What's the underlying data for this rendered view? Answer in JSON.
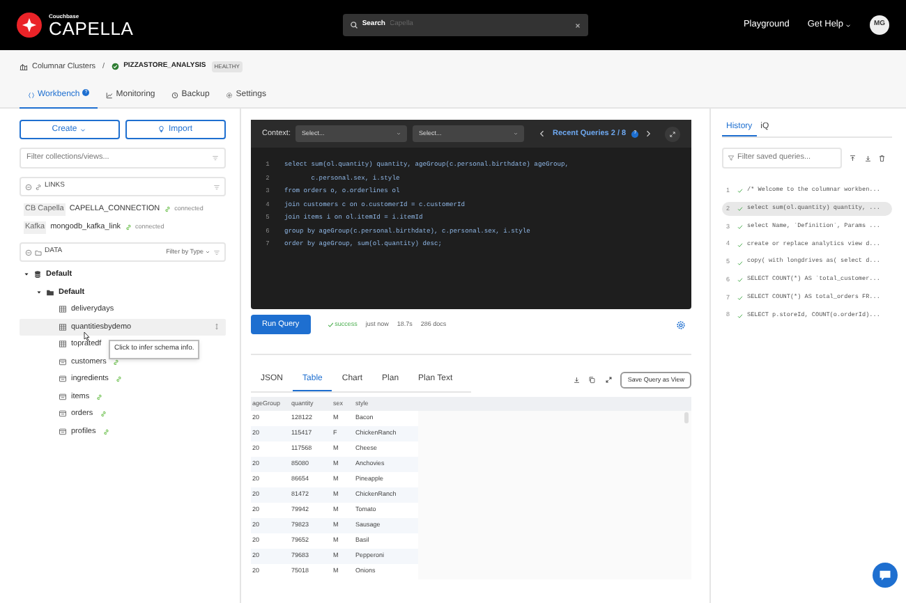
{
  "topbar": {
    "brand_small": "Couchbase",
    "brand": "CAPELLA",
    "search": {
      "label": "Search",
      "placeholder": "Capella"
    },
    "links": [
      "Playground",
      "Get Help"
    ],
    "avatar": "MG"
  },
  "breadcrumb": {
    "parent": "Columnar Clusters",
    "separator": "/",
    "cluster": "PIZZASTORE_ANALYSIS",
    "status": "HEALTHY"
  },
  "tabs": [
    {
      "label": "Workbench",
      "selected": true,
      "help": "?"
    },
    {
      "label": "Monitoring",
      "selected": false
    },
    {
      "label": "Backup",
      "selected": false
    },
    {
      "label": "Settings",
      "selected": false
    }
  ],
  "sidebar": {
    "create": "Create",
    "import": "Import",
    "filter_placeholder": "Filter collections/views...",
    "links_title": "LINKS",
    "links": [
      {
        "type": "CB Capella",
        "name": "CAPELLA_CONNECTION",
        "status": "connected"
      },
      {
        "type": "Kafka",
        "name": "mongodb_kafka_link",
        "status": "connected"
      }
    ],
    "data_title": "DATA",
    "filter_by_type": "Filter by Type",
    "tree": [
      {
        "label": "Default",
        "kind": "database",
        "expanded": true,
        "children": [
          {
            "label": "Default",
            "kind": "scope",
            "expanded": true,
            "children": [
              {
                "label": "deliverydays",
                "kind": "view",
                "linked": false,
                "selected": false
              },
              {
                "label": "quantitiesbydemo",
                "kind": "view",
                "linked": false,
                "selected": true
              },
              {
                "label": "topratedf",
                "kind": "view",
                "linked": false,
                "selected": false
              },
              {
                "label": "customers",
                "kind": "collection",
                "linked": true,
                "selected": false
              },
              {
                "label": "ingredients",
                "kind": "collection",
                "linked": true,
                "selected": false
              },
              {
                "label": "items",
                "kind": "collection",
                "linked": true,
                "selected": false
              },
              {
                "label": "orders",
                "kind": "collection",
                "linked": true,
                "selected": false
              },
              {
                "label": "profiles",
                "kind": "collection",
                "linked": true,
                "selected": false
              }
            ]
          }
        ]
      }
    ],
    "tooltip": "Click to infer schema info."
  },
  "editor": {
    "context_label": "Context:",
    "context_selects": [
      "Select...",
      "Select..."
    ],
    "recent": "Recent Queries 2 / 8",
    "recent_help": "?",
    "lines": [
      {
        "number": "1",
        "text": "select sum(ol.quantity) quantity, ageGroup(c.personal.birthdate) ageGroup,"
      },
      {
        "number": "2",
        "text": "       c.personal.sex, i.style"
      },
      {
        "number": "3",
        "text": "from orders o, o.orderlines ol"
      },
      {
        "number": "4",
        "text": "join customers c on o.customerId = c.customerId"
      },
      {
        "number": "5",
        "text": "join items i on ol.itemId = i.itemId"
      },
      {
        "number": "6",
        "text": "group by ageGroup(c.personal.birthdate), c.personal.sex, i.style"
      },
      {
        "number": "7",
        "text": "order by ageGroup, sum(ol.quantity) desc;"
      }
    ]
  },
  "run": {
    "button": "Run Query",
    "status": "success",
    "time": "just now",
    "elapsed": "18.7s",
    "docs": "286 docs"
  },
  "results": {
    "tabs": [
      {
        "label": "JSON",
        "selected": false
      },
      {
        "label": "Table",
        "selected": true
      },
      {
        "label": "Chart",
        "selected": false
      },
      {
        "label": "Plan",
        "selected": false
      },
      {
        "label": "Plan Text",
        "selected": false
      }
    ],
    "save_view": "Save Query as View",
    "table": {
      "columns": [
        "ageGroup",
        "quantity",
        "sex",
        "style"
      ],
      "rows": [
        [
          "20",
          "128122",
          "M",
          "Bacon"
        ],
        [
          "20",
          "115417",
          "F",
          "ChickenRanch"
        ],
        [
          "20",
          "117568",
          "M",
          "Cheese"
        ],
        [
          "20",
          "85080",
          "M",
          "Anchovies"
        ],
        [
          "20",
          "86654",
          "M",
          "Pineapple"
        ],
        [
          "20",
          "81472",
          "M",
          "ChickenRanch"
        ],
        [
          "20",
          "79942",
          "M",
          "Tomato"
        ],
        [
          "20",
          "79823",
          "M",
          "Sausage"
        ],
        [
          "20",
          "79652",
          "M",
          "Basil"
        ],
        [
          "20",
          "79683",
          "M",
          "Pepperoni"
        ],
        [
          "20",
          "75018",
          "M",
          "Onions"
        ]
      ]
    }
  },
  "history": {
    "tabs": [
      {
        "label": "History",
        "selected": true
      },
      {
        "label": "iQ",
        "selected": false
      }
    ],
    "filter_placeholder": "Filter saved queries...",
    "items": [
      {
        "number": "1",
        "text": "/* Welcome to the columnar workben...",
        "selected": false
      },
      {
        "number": "2",
        "text": "select sum(ol.quantity) quantity, ...",
        "selected": true
      },
      {
        "number": "3",
        "text": "select Name, `Definition`, Params ...",
        "selected": false
      },
      {
        "number": "4",
        "text": "create or replace analytics view d...",
        "selected": false
      },
      {
        "number": "5",
        "text": "copy( with longdrives as( select d...",
        "selected": false
      },
      {
        "number": "6",
        "text": "SELECT COUNT(*) AS `total_customer...",
        "selected": false
      },
      {
        "number": "7",
        "text": "SELECT COUNT(*) AS total_orders FR...",
        "selected": false
      },
      {
        "number": "8",
        "text": "SELECT p.storeId, COUNT(o.orderId)...",
        "selected": false
      }
    ]
  }
}
